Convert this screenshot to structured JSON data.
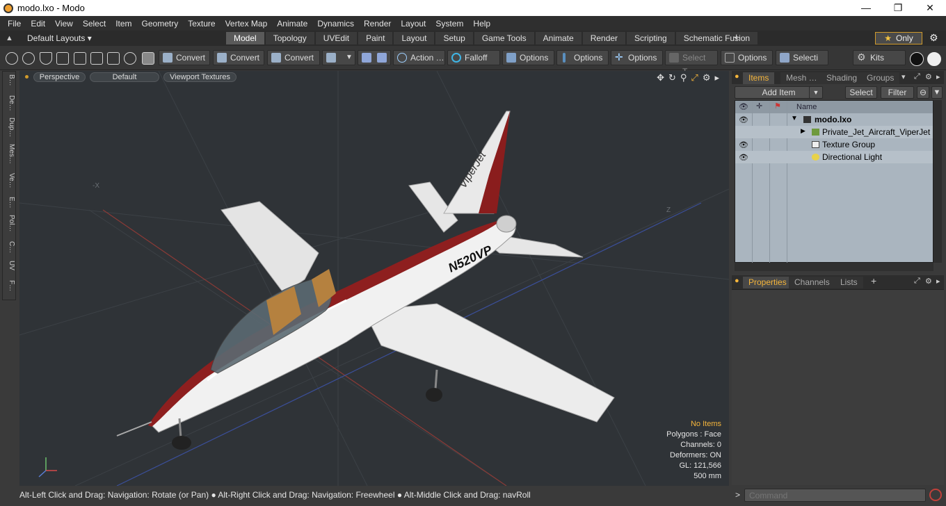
{
  "window": {
    "title": "modo.lxo - Modo",
    "minimize": "—",
    "maximize": "❐",
    "close": "✕"
  },
  "menu": [
    "File",
    "Edit",
    "View",
    "Select",
    "Item",
    "Geometry",
    "Texture",
    "Vertex Map",
    "Animate",
    "Dynamics",
    "Render",
    "Layout",
    "System",
    "Help"
  ],
  "layouts": {
    "label": "Default Layouts ▾"
  },
  "tabs": [
    "Model",
    "Topology",
    "UVEdit",
    "Paint",
    "Layout",
    "Setup",
    "Game Tools",
    "Animate",
    "Render",
    "Scripting",
    "Schematic Fusion"
  ],
  "active_tab": "Model",
  "only_button": {
    "star": "★",
    "label": "Only"
  },
  "toolbar": {
    "convert1": "Convert",
    "convert2": "Convert",
    "convert3": "Convert",
    "action": "Action …",
    "falloff": "Falloff",
    "options1": "Options",
    "options2": "Options",
    "options3": "Options",
    "select_t": "Select T…",
    "options4": "Options",
    "selecti": "Selecti …",
    "kits": "Kits"
  },
  "left_tabs": [
    "B…",
    "De…",
    "Dup…",
    "Mes…",
    "Ve…",
    "E…",
    "Pol…",
    "C…",
    "UV",
    "F…"
  ],
  "viewport": {
    "perspective": "Perspective",
    "default": "Default",
    "textures": "Viewport Textures",
    "axis_x": "-X",
    "axis_z": "Z",
    "stats": {
      "no_items": "No Items",
      "polygons": "Polygons : Face",
      "channels": "Channels: 0",
      "deformers": "Deformers: ON",
      "gl": "GL: 121,566",
      "scale": "500 mm"
    },
    "tail_text": "ViperJet",
    "reg_text": "N520VP"
  },
  "status": "Alt-Left Click and Drag: Navigation: Rotate (or Pan) ● Alt-Right Click and Drag: Navigation: Freewheel ● Alt-Middle Click and Drag: navRoll",
  "items_panel": {
    "tabs": [
      "Items",
      "Mesh …",
      "Shading",
      "Groups"
    ],
    "add_item": "Add Item",
    "select": "Select",
    "filter": "Filter",
    "name_header": "Name",
    "rows": [
      "modo.lxo",
      "Private_Jet_Aircraft_ViperJet",
      "Texture Group",
      "Directional Light"
    ]
  },
  "props_panel": {
    "tabs": [
      "Properties",
      "Channels",
      "Lists"
    ]
  },
  "command": {
    "placeholder": "Command"
  }
}
